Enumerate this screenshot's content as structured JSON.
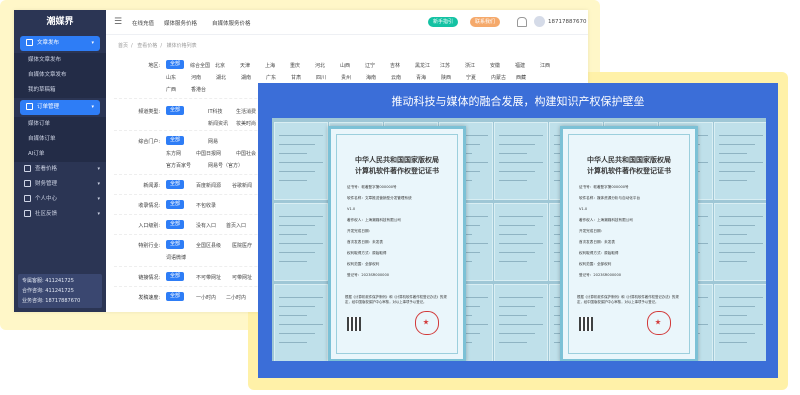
{
  "sidebar": {
    "logo": "潮媒界",
    "items": [
      {
        "label": "文章发布",
        "active": true,
        "chevron": "▾"
      },
      {
        "label": "媒体文章发布"
      },
      {
        "label": "自媒体文章发布"
      },
      {
        "label": "我的草稿箱"
      },
      {
        "label": "订单管理",
        "active": true,
        "chevron": "▾"
      },
      {
        "label": "媒体订单"
      },
      {
        "label": "自媒体订单"
      },
      {
        "label": "AI订单"
      },
      {
        "label": "查看价格",
        "chevron": "▾"
      },
      {
        "label": "财务管理",
        "chevron": "▾"
      },
      {
        "label": "个人中心",
        "chevron": "▾"
      },
      {
        "label": "社区反馈",
        "chevron": "▾"
      }
    ],
    "contacts": [
      "专属客服: 411241725",
      "合作咨询: 411241725",
      "业务咨询: 18717887670"
    ]
  },
  "topbar": {
    "links": [
      "在线充值",
      "媒体服务价格",
      "自媒体服务价格"
    ],
    "pill_new": "新手指引",
    "pill_contact": "联系我们",
    "phone": "18717887670",
    "colors": {
      "pill_new": "#13c2a3",
      "pill_contact": "#f5a96b"
    }
  },
  "breadcrumb": [
    "首页",
    "查看价格",
    "媒体价格列表"
  ],
  "filters": {
    "all_label": "全部",
    "region_label": "地区:",
    "region_row1": [
      "综合全国",
      "北京",
      "天津",
      "上海",
      "重庆",
      "河北",
      "山西",
      "辽宁",
      "吉林",
      "黑龙江",
      "江苏",
      "浙江",
      "安徽",
      "福建",
      "江西"
    ],
    "region_row2": [
      "山东",
      "河南",
      "湖北",
      "湖南",
      "广东",
      "甘肃",
      "四川",
      "贵州",
      "海南",
      "云南",
      "青海",
      "陕西",
      "宁夏",
      "内蒙古",
      "西藏"
    ],
    "region_row3": [
      "广西",
      "香港台"
    ],
    "channel_label": "频道类型:",
    "channel_row1": [
      "IT科技",
      "生活消费"
    ],
    "channel_row2": [
      "新闻资讯",
      "妆美时尚"
    ],
    "portal_label": "综合门户:",
    "portal_row1": [
      "网易"
    ],
    "portal_row2": [
      "东方网",
      "中国日报网",
      "中国社会"
    ],
    "portal_row3": [
      "官方百家号",
      "网易号（官方）"
    ],
    "news_label": "新闻源:",
    "news_opts": [
      "百度新闻源",
      "谷歌新闻"
    ],
    "index_label": "收录情况:",
    "index_opts": [
      "不包收录"
    ],
    "entry_label": "入口级别:",
    "entry_opts": [
      "没有入口",
      "首页入口"
    ],
    "special_label": "特别行业:",
    "special_row1": [
      "全国区县级",
      "医院医疗"
    ],
    "special_row2": [
      "词语微博"
    ],
    "link_label": "链接情况:",
    "link_opts": [
      "不可带网址",
      "可带网址"
    ],
    "speed_label": "发稿速度:",
    "speed_opts": [
      "一小时内",
      "二小时内"
    ]
  },
  "overlay": {
    "title": "推动科技与媒体的融合发展，构建知识产权保护壁垒",
    "cert_title_1": "中华人民共和国国家版权局",
    "cert_title_2": "计算机软件著作权登记证书",
    "cert_left_lines": [
      "证书号：软著登字第000000号",
      "软件名称：文章推送营销型分发管理系统",
      "V1.0",
      "著作权人：上海潮媒科技有限公司",
      "开发完成日期：",
      "首次发表日期：未发表",
      "权利取得方式：原始取得",
      "权利范围：全部权利",
      "登记号：2023SR000000"
    ],
    "cert_right_lines": [
      "证书号：软著登字第000000号",
      "软件名称：媒体资源分析与自动化平台",
      "V1.0",
      "著作权人：上海潮媒科技有限公司",
      "开发完成日期：",
      "首次发表日期：未发表",
      "权利取得方式：原始取得",
      "权利范围：全部权利",
      "登记号：2023SR000000"
    ],
    "cert_bottom": "根据《计算机软件保护条例》和《计算机软件著作权登记办法》的规定，经中国版权保护中心审核，对以上事项予以登记。",
    "colors": {
      "panel": "#3b6ed8",
      "cert_border": "#7cc1d6",
      "seal": "#d23a3a"
    }
  }
}
